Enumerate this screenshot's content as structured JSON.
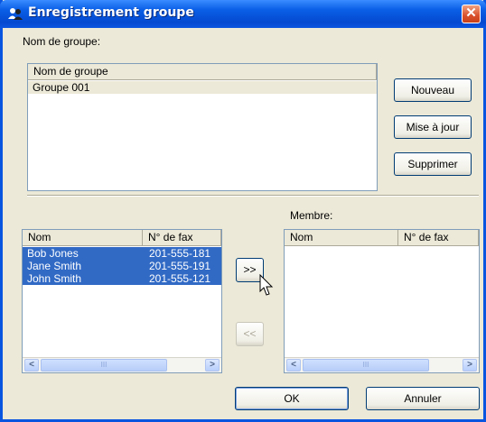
{
  "window": {
    "title": "Enregistrement groupe",
    "close_glyph": "✕",
    "colors": {
      "titlebar": "#0a55e0",
      "selection": "#316ac5",
      "close": "#d8502a"
    }
  },
  "group_section": {
    "label": "Nom de groupe:",
    "column_header": "Nom de groupe",
    "rows": [
      "Groupe 001"
    ]
  },
  "buttons": {
    "new": "Nouveau",
    "update": "Mise à jour",
    "delete": "Supprimer",
    "add": ">>",
    "remove": "<<",
    "ok": "OK",
    "cancel": "Annuler"
  },
  "contacts": {
    "headers": [
      "Nom",
      "N° de fax"
    ],
    "rows": [
      {
        "name": "Bob Jones",
        "fax": "201-555-181"
      },
      {
        "name": "Jane Smith",
        "fax": "201-555-191"
      },
      {
        "name": "John Smith",
        "fax": "201-555-121"
      }
    ]
  },
  "members": {
    "label": "Membre:",
    "headers": [
      "Nom",
      "N° de fax"
    ],
    "rows": []
  },
  "scrollbar": {
    "left_glyph": "<",
    "right_glyph": ">",
    "thumb_glyph": "III"
  },
  "icons": {
    "title_icon": "group-people-icon",
    "cursor": "arrow-cursor-icon"
  }
}
